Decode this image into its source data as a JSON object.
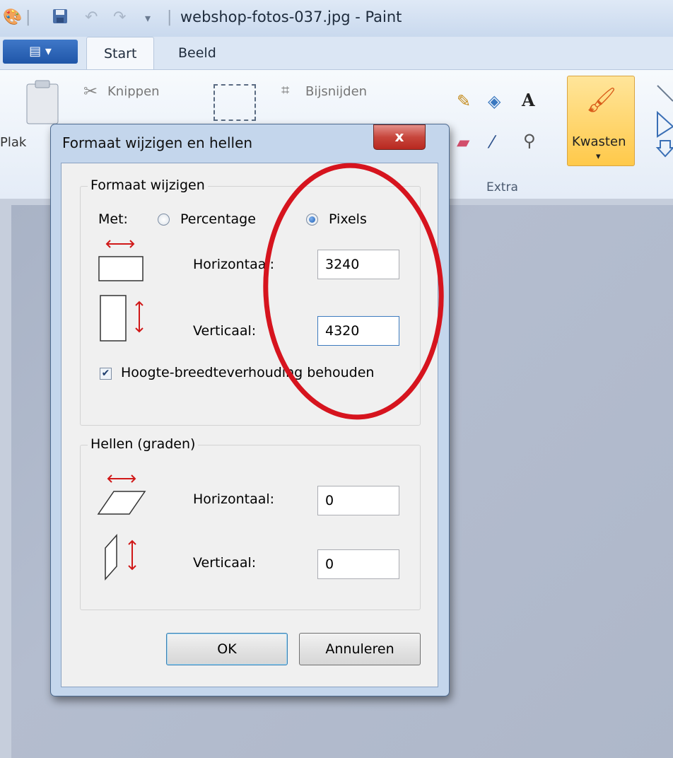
{
  "window": {
    "title": "webshop-fotos-037.jpg - Paint"
  },
  "quick_access": [
    "paint-logo-icon",
    "save-icon",
    "undo-icon",
    "redo-icon",
    "qat-dropdown-icon"
  ],
  "tabs": [
    {
      "label": "Start"
    },
    {
      "label": "Beeld"
    }
  ],
  "ribbon": {
    "cut": "Knippen",
    "crop": "Bijsnijden",
    "paste_partial": "Plak",
    "extra": "Extra",
    "brushes": "Kwasten"
  },
  "dialog": {
    "title": "Formaat wijzigen en hellen",
    "close_glyph": "x",
    "resize": {
      "heading": "Formaat wijzigen",
      "by_label": "Met:",
      "options": [
        "Percentage",
        "Pixels"
      ],
      "selected": "Pixels",
      "horizontal_label": "Horizontaal:",
      "horizontal_value": "3240",
      "vertical_label": "Verticaal:",
      "vertical_value": "4320",
      "keep_ratio_label": "Hoogte-breedteverhouding behouden",
      "keep_ratio_checked": true
    },
    "skew": {
      "heading": "Hellen (graden)",
      "horizontal_label": "Horizontaal:",
      "horizontal_value": "0",
      "vertical_label": "Verticaal:",
      "vertical_value": "0"
    },
    "ok": "OK",
    "cancel": "Annuleren"
  },
  "annotation": {
    "color": "#d6141e",
    "shape": "ellipse"
  }
}
